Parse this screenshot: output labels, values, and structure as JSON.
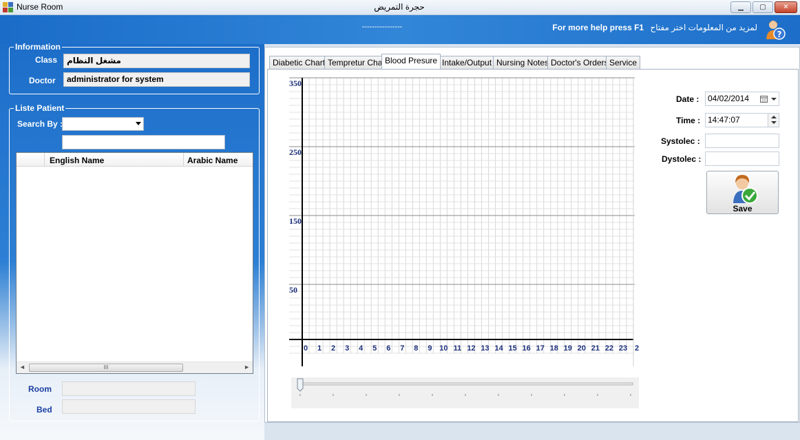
{
  "window": {
    "title": "Nurse Room",
    "center_title": "حجرة التمريض",
    "minimize": "▁",
    "maximize": "▢",
    "close": "✕"
  },
  "header": {
    "dashes": "----------------",
    "help_en": "For more help press F1",
    "help_ar": "لمزيد من المعلومات اختر مفتاح",
    "help_icon": "help-user-icon"
  },
  "information": {
    "legend": "Information",
    "class_label": "Class",
    "class_value": "مشغل النظام",
    "doctor_label": "Doctor",
    "doctor_value": "administrator for system"
  },
  "patients": {
    "legend": "Liste Patient",
    "search_label": "Search By :",
    "search_value": "",
    "filter_value": "",
    "columns": [
      "English Name",
      "Arabic Name"
    ],
    "scroll_grip": "III",
    "scroll_left": "◄",
    "scroll_right": "►",
    "room_label": "Room",
    "bed_label": "Bed"
  },
  "tabs": [
    {
      "label": "Diabetic Chart"
    },
    {
      "label": "Tempretur Chart"
    },
    {
      "label": "Blood Presure"
    },
    {
      "label": "Intake/Output"
    },
    {
      "label": "Nursing Notes"
    },
    {
      "label": "Doctor's Orders"
    },
    {
      "label": "Service"
    }
  ],
  "active_tab": "Blood Presure",
  "form": {
    "date_label": "Date :",
    "date_value": "04/02/2014",
    "time_label": "Time :",
    "time_value": "14:47:07",
    "systolic_label": "Systolec :",
    "systolic_value": "",
    "diastolic_label": "Dystolec :",
    "diastolic_value": "",
    "save_label": "Save"
  },
  "chart_data": {
    "type": "line",
    "y_tick_labels": [
      "350",
      "250",
      "150",
      "50"
    ],
    "x_tick_labels": [
      "0",
      "1",
      "2",
      "3",
      "4",
      "5",
      "6",
      "7",
      "8",
      "9",
      "10",
      "11",
      "12",
      "13",
      "14",
      "15",
      "16",
      "17",
      "18",
      "19",
      "20",
      "21",
      "22",
      "23",
      "2"
    ],
    "series": [],
    "grid": true,
    "tick_color": "#1b2f7a"
  },
  "trackbar": {
    "value": 0,
    "ticks": 11
  }
}
